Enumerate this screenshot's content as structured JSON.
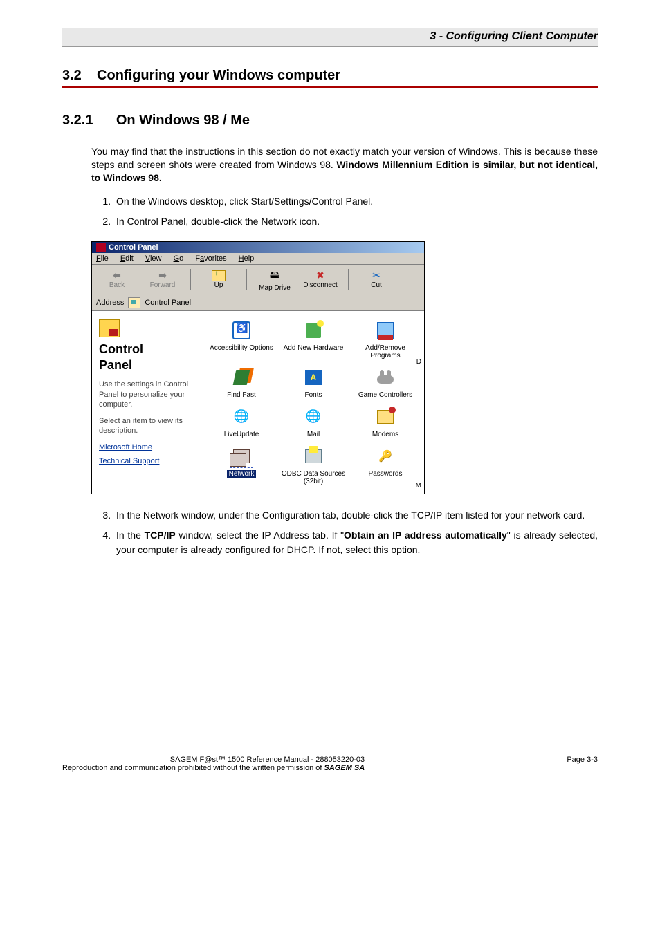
{
  "header": {
    "running_title": "3 - Configuring Client Computer"
  },
  "section": {
    "number": "3.2",
    "title": "Configuring your Windows computer"
  },
  "subsection": {
    "number": "3.2.1",
    "title": "On Windows 98 / Me"
  },
  "intro": {
    "p1a": "You may find that the instructions in this section do not exactly match your version of Windows. This is because these steps and screen shots were created from Windows 98. ",
    "p1b": "Windows Millennium Edition is similar, but not identical, to Windows 98."
  },
  "steps": {
    "s1": "On the Windows desktop, click Start/Settings/Control Panel.",
    "s2": "In Control Panel, double-click the Network icon.",
    "s3": "In the Network window, under the Configuration tab, double-click the TCP/IP item listed for your network card.",
    "s4a": "In the ",
    "s4b": "TCP/IP",
    "s4c": " window, select the IP Address tab. If \"",
    "s4d": "Obtain an IP address automatically",
    "s4e": "\" is already selected, your computer is already configured for DHCP. If not, select this option."
  },
  "cp": {
    "title": "Control Panel",
    "menu": {
      "file": "File",
      "edit": "Edit",
      "view": "View",
      "go": "Go",
      "fav": "Favorites",
      "help": "Help"
    },
    "toolbar": {
      "back": "Back",
      "forward": "Forward",
      "up": "Up",
      "map": "Map Drive",
      "disc": "Disconnect",
      "cut": "Cut"
    },
    "address_label": "Address",
    "address_value": "Control Panel",
    "left": {
      "title1": "Control",
      "title2": "Panel",
      "desc": "Use the settings in Control Panel to personalize your computer.",
      "desc2": "Select an item to view its description.",
      "link1": "Microsoft Home",
      "link2": "Technical Support"
    },
    "items": {
      "access": "Accessibility Options",
      "addhw": "Add New Hardware",
      "addrm": "Add/Remove Programs",
      "findfast": "Find Fast",
      "fonts": "Fonts",
      "game": "Game Controllers",
      "live": "LiveUpdate",
      "mail": "Mail",
      "modem": "Modems",
      "network": "Network",
      "odbc": "ODBC Data Sources (32bit)",
      "pass": "Passwords"
    },
    "cut_d": "D",
    "cut_m": "M"
  },
  "footer": {
    "line1": "SAGEM F@st™ 1500 Reference Manual - 288053220-03",
    "line2a": "Reproduction and communication prohibited without the written permission of ",
    "line2b": "SAGEM SA",
    "page": "Page 3-3"
  }
}
